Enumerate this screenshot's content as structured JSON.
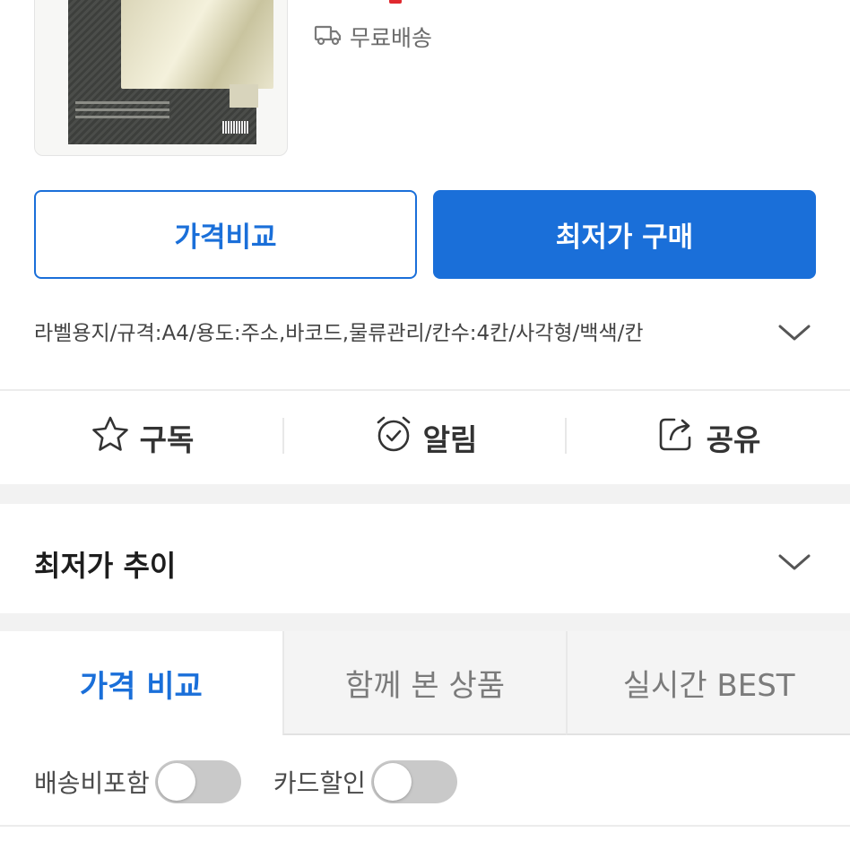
{
  "product": {
    "shipping_label": "무료배송"
  },
  "buttons": {
    "compare_label": "가격비교",
    "buy_label": "최저가 구매"
  },
  "spec": {
    "text": "라벨용지/규격:A4/용도:주소,바코드,물류관리/칸수:4칸/사각형/백색/칸"
  },
  "actions": [
    {
      "label": "구독",
      "icon": "star-icon"
    },
    {
      "label": "알림",
      "icon": "alarm-clock-icon"
    },
    {
      "label": "공유",
      "icon": "share-icon"
    }
  ],
  "trend": {
    "title": "최저가 추이"
  },
  "tabs": [
    {
      "label": "가격 비교",
      "active": true
    },
    {
      "label": "함께 본 상품",
      "active": false
    },
    {
      "label": "실시간 BEST",
      "active": false
    }
  ],
  "filters": [
    {
      "label": "배송비포함",
      "on": false
    },
    {
      "label": "카드할인",
      "on": false
    }
  ],
  "colors": {
    "accent": "#1a6fd9",
    "price": "#e0292f",
    "muted": "#6b6b6b"
  }
}
